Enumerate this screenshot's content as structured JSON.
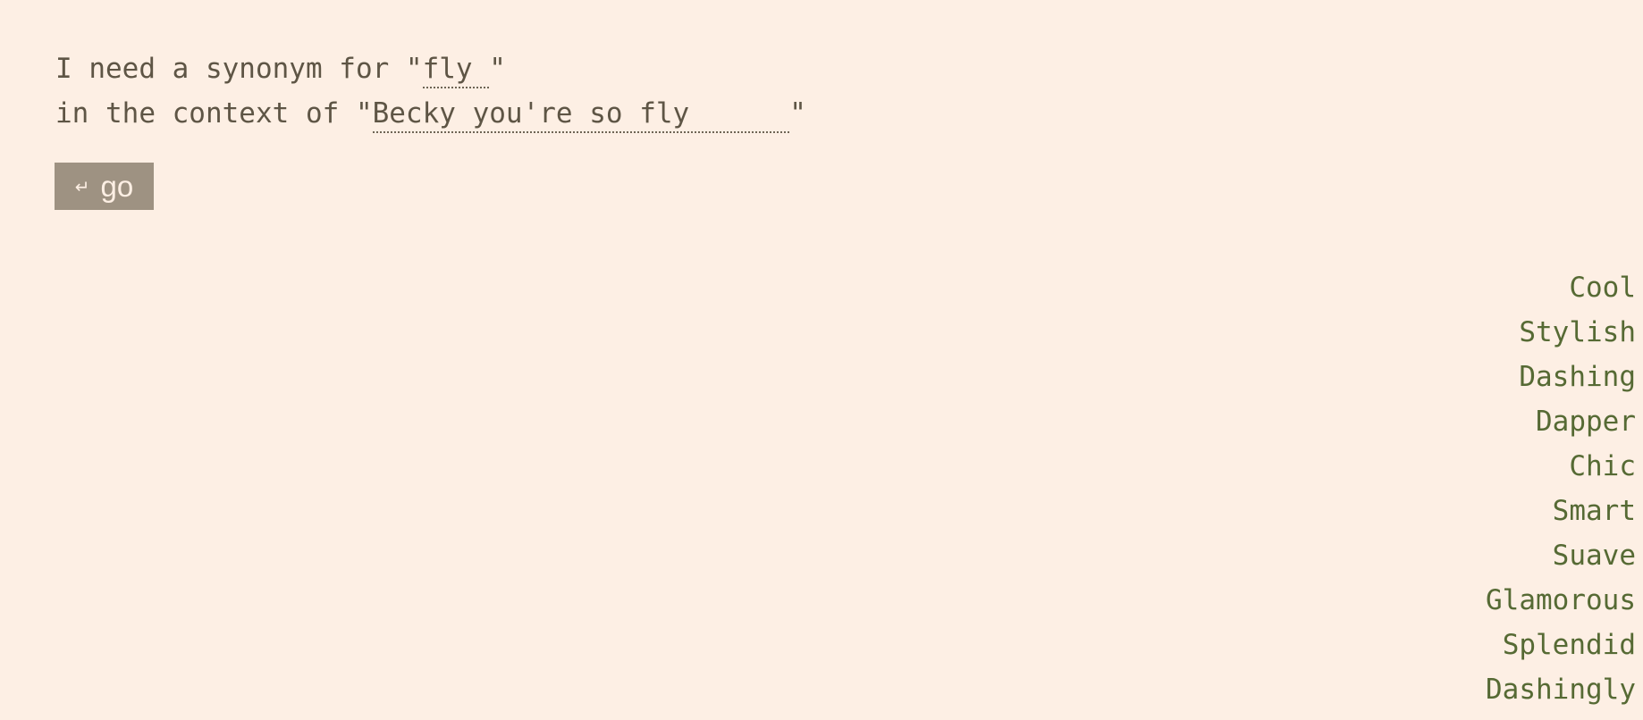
{
  "prompt": {
    "line1_prefix": "I need a synonym for \"",
    "word": "fly ",
    "line1_suffix": "\"",
    "line2_prefix": "in the context of \"",
    "context": "Becky you're so fly      ",
    "line2_suffix": "\""
  },
  "button": {
    "icon": "↵",
    "label": "go"
  },
  "results": [
    "Cool",
    "Stylish",
    "Dashing",
    "Dapper",
    "Chic",
    "Smart",
    "Suave",
    "Glamorous",
    "Splendid",
    "Dashingly"
  ],
  "colors": {
    "background": "#fdefe4",
    "text": "#5e5545",
    "button": "#9e9282",
    "result": "#566a34"
  }
}
